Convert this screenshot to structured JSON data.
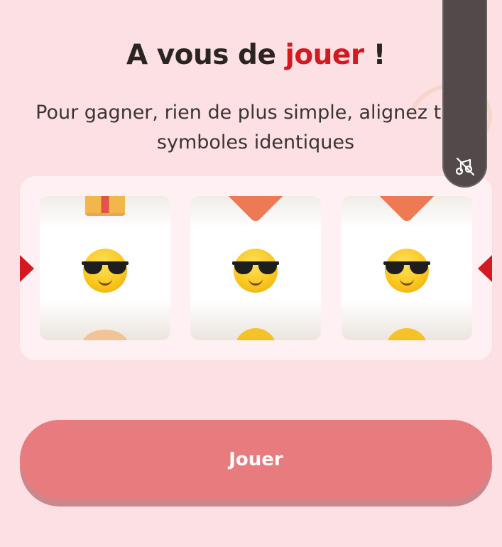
{
  "header": {
    "title_prefix": "A vous de ",
    "title_accent": "jouer",
    "title_suffix": " !",
    "subtitle": "Pour gagner, rien de plus simple, alignez trois symboles identiques"
  },
  "reels": [
    {
      "top_symbol": "gift-icon",
      "center_symbol": "sunglasses-smiley-icon",
      "bottom_symbol": "heart-icon"
    },
    {
      "top_symbol": "heart-icon",
      "center_symbol": "sunglasses-smiley-icon",
      "bottom_symbol": "smiley-icon"
    },
    {
      "top_symbol": "heart-icon",
      "center_symbol": "sunglasses-smiley-icon",
      "bottom_symbol": "smiley-icon"
    }
  ],
  "play_button": {
    "label": "Jouer"
  },
  "side_panel": {
    "icon": "sound-off-icon"
  },
  "colors": {
    "background": "#fde0e4",
    "accent_red": "#d31a20",
    "button": "#e87b7e",
    "side_panel": "#524a4a"
  }
}
